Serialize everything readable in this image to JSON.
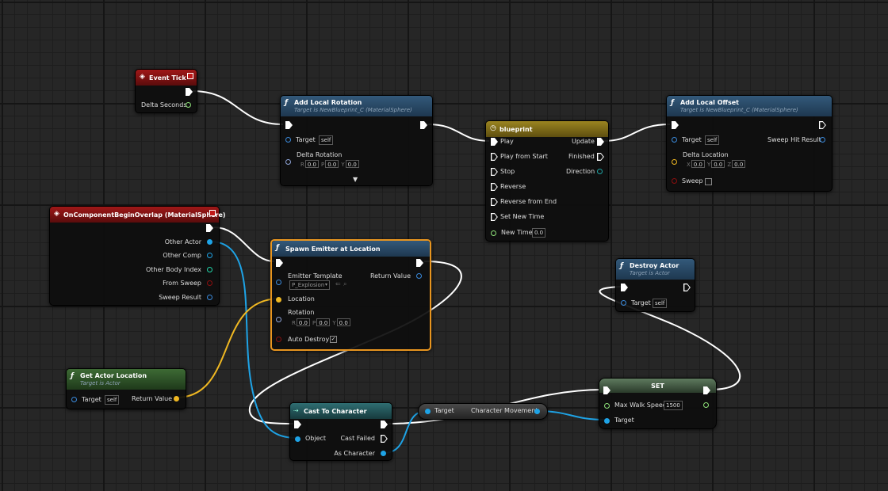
{
  "colors": {
    "event_header": "#8a1414",
    "function_header": "#2a4d6e",
    "timeline_header": "#8f7a1a",
    "pure_header": "#2f5a2a",
    "cast_header": "#2b6064",
    "set_header": "#4e6a4e",
    "exec_wire": "#ffffff",
    "object_wire": "#1ea3e6",
    "vector_wire": "#f0b822",
    "float_pin": "#8fe37a",
    "struct_pin": "#3a8adc",
    "bool_pin": "#8b0f0f"
  },
  "event_tick": {
    "icon": "event-diamond-icon",
    "title": "Event Tick",
    "delta_seconds": "Delta Seconds"
  },
  "add_local_rotation": {
    "title": "Add Local Rotation",
    "subtitle": "Target is NewBlueprint_C (MaterialSphere)",
    "target": "Target",
    "target_value": "self",
    "delta_rotation": "Delta Rotation",
    "r_key": "R",
    "r_value": "0.0",
    "p_key": "P",
    "p_value": "0.0",
    "y_key": "Y",
    "y_value": "0.0",
    "expand_icon": "expand-arrow-icon"
  },
  "timeline": {
    "icon": "clock-icon",
    "title": "blueprint",
    "play": "Play",
    "play_from_start": "Play from Start",
    "stop": "Stop",
    "reverse": "Reverse",
    "reverse_from_end": "Reverse from End",
    "set_new_time": "Set New Time",
    "new_time": "New Time",
    "new_time_value": "0.0",
    "update": "Update",
    "finished": "Finished",
    "direction": "Direction"
  },
  "add_local_offset": {
    "title": "Add Local Offset",
    "subtitle": "Target is NewBlueprint_C (MaterialSphere)",
    "target": "Target",
    "target_value": "self",
    "delta_location": "Delta Location",
    "x_key": "X",
    "x_value": "0.0",
    "y_key": "Y",
    "y_value": "0.0",
    "z_key": "Z",
    "z_value": "0.0",
    "sweep": "Sweep",
    "sweep_hit_result": "Sweep Hit Result"
  },
  "overlap_event": {
    "title": "OnComponentBeginOverlap (MaterialSphere)",
    "other_actor": "Other Actor",
    "other_comp": "Other Comp",
    "other_body_index": "Other Body Index",
    "from_sweep": "From Sweep",
    "sweep_result": "Sweep Result"
  },
  "spawn_emitter": {
    "title": "Spawn Emitter at Location",
    "emitter_template": "Emitter Template",
    "emitter_value": "P_Explosion",
    "return_value": "Return Value",
    "location": "Location",
    "rotation": "Rotation",
    "r_key": "R",
    "r_value": "0.0",
    "p_key": "P",
    "p_value": "0.0",
    "y_key": "Y",
    "y_value": "0.0",
    "auto_destroy": "Auto Destroy",
    "auto_destroy_checked": true
  },
  "destroy_actor": {
    "title": "Destroy Actor",
    "subtitle": "Target is Actor",
    "target": "Target",
    "target_value": "self"
  },
  "get_actor_location": {
    "title": "Get Actor Location",
    "subtitle": "Target is Actor",
    "target": "Target",
    "target_value": "self",
    "return_value": "Return Value"
  },
  "cast_to_character": {
    "title": "Cast To Character",
    "object": "Object",
    "cast_failed": "Cast Failed",
    "as_character": "As Character"
  },
  "get_character_movement": {
    "target": "Target",
    "output": "Character Movement"
  },
  "set_node": {
    "title": "SET",
    "max_walk_speed": "Max Walk Speed",
    "max_walk_speed_value": "1500",
    "target": "Target"
  }
}
